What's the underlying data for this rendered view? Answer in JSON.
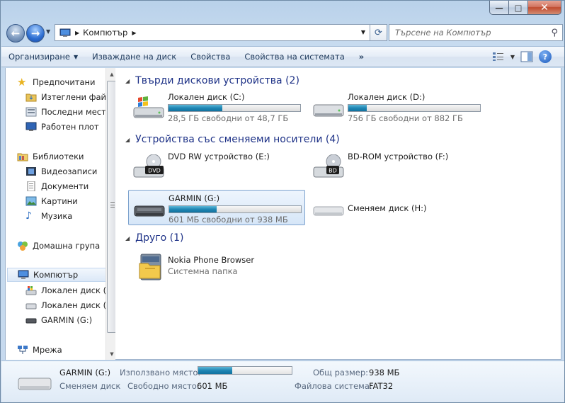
{
  "window": {
    "minimize_glyph": "—",
    "maximize_glyph": "□",
    "close_glyph": "✕"
  },
  "address": {
    "path": "Компютър",
    "search_placeholder": "Търсене на Компютър"
  },
  "toolbar": {
    "organize": "Организиране",
    "eject": "Изваждане на диск",
    "properties": "Свойства",
    "system_properties": "Свойства на системата",
    "more": "»"
  },
  "nav": {
    "favorites": "Предпочитани",
    "downloads": "Изтеглени файлове",
    "recent": "Последни места",
    "desktop": "Работен плот",
    "libraries": "Библиотеки",
    "videos": "Видеозаписи",
    "documents": "Документи",
    "pictures": "Картини",
    "music": "Музика",
    "homegroup": "Домашна група",
    "computer": "Компютър",
    "local_c": "Локален диск (C:)",
    "local_d": "Локален диск (D:)",
    "garmin": "GARMIN (G:)",
    "network": "Мрежа"
  },
  "groups": {
    "hard_disks": "Твърди дискови устройства (2)",
    "removable": "Устройства със сменяеми носители (4)",
    "other": "Друго (1)"
  },
  "drives": {
    "c": {
      "name": "Локален диск (C:)",
      "free": "28,5 ГБ свободни от 48,7 ГБ",
      "used_fraction": 0.41
    },
    "d": {
      "name": "Локален диск (D:)",
      "free": "756 ГБ свободни от 882 ГБ",
      "used_fraction": 0.14
    },
    "e": {
      "name": "DVD RW устройство (E:)",
      "badge": "DVD"
    },
    "f": {
      "name": "BD-ROM устройство (F:)",
      "badge": "BD"
    },
    "g": {
      "name": "GARMIN (G:)",
      "free": "601 МБ свободни от 938 МБ",
      "used_fraction": 0.36
    },
    "h": {
      "name": "Сменяем диск (H:)"
    },
    "nokia": {
      "name": "Nokia Phone Browser",
      "sub": "Системна папка"
    }
  },
  "details": {
    "name": "GARMIN (G:)",
    "type": "Сменяем диск",
    "used_label": "Използвано място:",
    "free_label": "Свободно място:",
    "free_value": "601 МБ",
    "total_label": "Общ размер:",
    "total_value": "938 МБ",
    "fs_label": "Файлова система:",
    "fs_value": "FAT32",
    "used_fraction": 0.36
  }
}
